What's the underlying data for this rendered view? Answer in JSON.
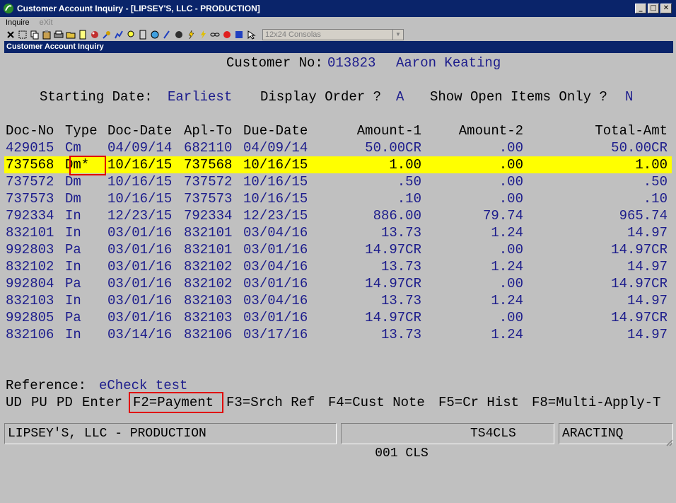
{
  "window": {
    "title": "Customer Account Inquiry - [LIPSEY'S, LLC - PRODUCTION]"
  },
  "menu": {
    "inquire": "Inquire",
    "exit": "eXit"
  },
  "toolbar": {
    "font_select": "12x24 Consolas"
  },
  "subtitle": "Customer Account Inquiry",
  "header": {
    "customer_label": "Customer No:",
    "customer_no": "013823",
    "customer_name": "Aaron Keating",
    "starting_date_label": "Starting Date:",
    "starting_date": "Earliest",
    "display_order_label": "Display Order ?",
    "display_order": "A",
    "open_items_label": "Show Open Items Only ?",
    "open_items": "N"
  },
  "table": {
    "columns": [
      "Doc-No",
      "Type",
      "Doc-Date",
      "Apl-To",
      "Due-Date",
      "Amount-1",
      "Amount-2",
      "Total-Amt"
    ],
    "rows": [
      [
        "429015",
        "Cm",
        "04/09/14",
        "682110",
        "04/09/14",
        "50.00CR",
        ".00",
        "50.00CR"
      ],
      [
        "737568",
        "Dm*",
        "10/16/15",
        "737568",
        "10/16/15",
        "1.00",
        ".00",
        "1.00"
      ],
      [
        "737572",
        "Dm",
        "10/16/15",
        "737572",
        "10/16/15",
        ".50",
        ".00",
        ".50"
      ],
      [
        "737573",
        "Dm",
        "10/16/15",
        "737573",
        "10/16/15",
        ".10",
        ".00",
        ".10"
      ],
      [
        "792334",
        "In",
        "12/23/15",
        "792334",
        "12/23/15",
        "886.00",
        "79.74",
        "965.74"
      ],
      [
        "832101",
        "In",
        "03/01/16",
        "832101",
        "03/04/16",
        "13.73",
        "1.24",
        "14.97"
      ],
      [
        "992803",
        "Pa",
        "03/01/16",
        "832101",
        "03/01/16",
        "14.97CR",
        ".00",
        "14.97CR"
      ],
      [
        "832102",
        "In",
        "03/01/16",
        "832102",
        "03/04/16",
        "13.73",
        "1.24",
        "14.97"
      ],
      [
        "992804",
        "Pa",
        "03/01/16",
        "832102",
        "03/01/16",
        "14.97CR",
        ".00",
        "14.97CR"
      ],
      [
        "832103",
        "In",
        "03/01/16",
        "832103",
        "03/04/16",
        "13.73",
        "1.24",
        "14.97"
      ],
      [
        "992805",
        "Pa",
        "03/01/16",
        "832103",
        "03/01/16",
        "14.97CR",
        ".00",
        "14.97CR"
      ],
      [
        "832106",
        "In",
        "03/14/16",
        "832106",
        "03/17/16",
        "13.73",
        "1.24",
        "14.97"
      ]
    ],
    "selected_row": 1
  },
  "reference": {
    "label": "Reference:",
    "value": "eCheck test"
  },
  "fkeys": {
    "ud": "UD",
    "pu": "PU",
    "pd": "PD",
    "enter": "Enter",
    "f2": "F2=Payment",
    "f3": "F3=Srch Ref",
    "f4": "F4=Cust Note",
    "f5": "F5=Cr Hist",
    "f8": "F8=Multi-Apply-T"
  },
  "status": {
    "company": "LIPSEY'S, LLC - PRODUCTION",
    "code": "001 CLS",
    "server": "TS4CLS",
    "program": "ARACTINQ"
  },
  "colors": {
    "title_bg": "#0a246a",
    "highlight": "#ffff00",
    "field_blue": "#1c1c8c",
    "annotation": "#e00000"
  }
}
